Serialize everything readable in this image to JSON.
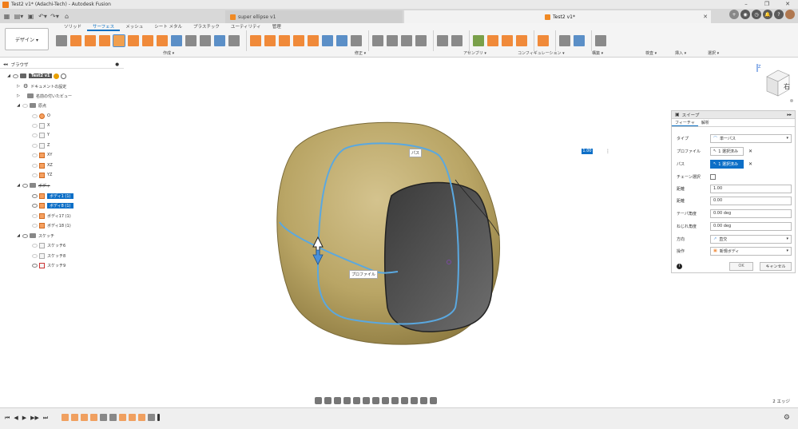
{
  "window": {
    "title": "Test2 v1* (Adachi-Tech) - Autodesk Fusion"
  },
  "doc_tabs": [
    {
      "label": "super ellipse v1"
    },
    {
      "label": "Test2 v1*"
    }
  ],
  "ribbon": {
    "workspace": "デザイン ▾",
    "tabs": [
      "ソリッド",
      "サーフェス",
      "メッシュ",
      "シート メタル",
      "プラスチック",
      "ユーティリティ",
      "管理"
    ],
    "active_tab": "サーフェス",
    "groups": [
      "作成 ▾",
      "修正 ▾",
      "アセンブリ ▾",
      "コンフィギュレーション ▾",
      "構築 ▾",
      "検査 ▾",
      "挿入 ▾",
      "選択 ▾"
    ]
  },
  "browser": {
    "title": "ブラウザ",
    "root": "Test2 v1",
    "items": [
      {
        "label": "ドキュメントの設定"
      },
      {
        "label": "名前の付いたビュー"
      },
      {
        "label": "原点"
      },
      {
        "label": "O"
      },
      {
        "label": "X"
      },
      {
        "label": "Y"
      },
      {
        "label": "Z"
      },
      {
        "label": "XY"
      },
      {
        "label": "XZ"
      },
      {
        "label": "YZ"
      },
      {
        "label": "ボディ"
      },
      {
        "label": "ボディ1 (1)"
      },
      {
        "label": "ボディ8 (1)"
      },
      {
        "label": "ボディ17 (1)"
      },
      {
        "label": "ボディ18 (1)"
      },
      {
        "label": "スケッチ"
      },
      {
        "label": "スケッチ6"
      },
      {
        "label": "スケッチ8"
      },
      {
        "label": "スケッチ9"
      }
    ]
  },
  "viewport": {
    "path_label": "パス",
    "profile_label": "プロファイル",
    "distance_value": "1.00",
    "status": "2 エッジ"
  },
  "viewcube": {
    "face": "右",
    "axis": "Z"
  },
  "sweep": {
    "title": "スイープ",
    "tabs": [
      "フィーチャ",
      "解析"
    ],
    "rows": [
      {
        "label": "タイプ",
        "value": "単一パス"
      },
      {
        "label": "プロファイル",
        "value": "1 選択済み"
      },
      {
        "label": "パス",
        "value": "1 選択済み"
      },
      {
        "label": "チェーン選択",
        "value": ""
      },
      {
        "label": "距離",
        "value": "1.00"
      },
      {
        "label": "距離",
        "value": "0.00"
      },
      {
        "label": "テーパ角度",
        "value": "0.00 deg"
      },
      {
        "label": "ねじれ角度",
        "value": "0.00 deg"
      },
      {
        "label": "方向",
        "value": "直交"
      },
      {
        "label": "操作",
        "value": "新規ボディ"
      }
    ],
    "ok": "OK",
    "cancel": "キャンセル"
  }
}
